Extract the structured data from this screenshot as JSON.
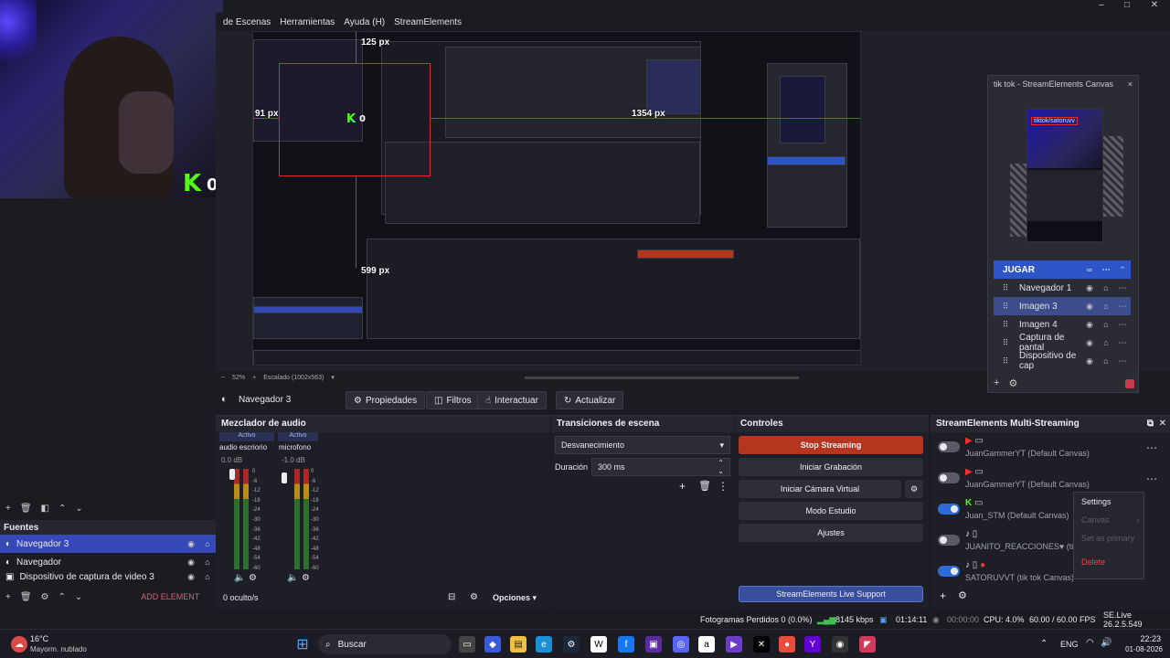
{
  "menubar": {
    "items": [
      "de Escenas",
      "Herramientas",
      "Ayuda (H)",
      "StreamElements"
    ]
  },
  "window_controls": {
    "minimize": "–",
    "maximize": "□",
    "close": "✕"
  },
  "webcam": {
    "kick_count": "0"
  },
  "preview": {
    "measures": {
      "top": "125 px",
      "left": "91 px",
      "right": "1354 px",
      "bottom": "599 px"
    },
    "nested_kick": "0"
  },
  "tiktok_panel": {
    "title": "tik tok - StreamElements Canvas",
    "scene_header": "JUGAR",
    "scenes": [
      "Navegador 1",
      "Imagen 3",
      "Imagen 4",
      "Captura de pantal",
      "Dispositivo de cap"
    ],
    "canvas_text": "tiktok/satoruvv"
  },
  "zoombar": {
    "minus": "−",
    "zoom": "52%",
    "plus": "+",
    "scale": "Escalado (1002x563)"
  },
  "source_bar": {
    "name": "Navegador 3",
    "properties": "Propiedades",
    "filters": "Filtros",
    "interact": "Interactuar",
    "refresh": "Actualizar"
  },
  "sources": {
    "title": "Fuentes",
    "items": [
      "Navegador 3",
      "Navegador",
      "Dispositivo de captura de video 3"
    ],
    "add_element": "ADD ELEMENT"
  },
  "audio_mixer": {
    "title": "Mezclador de audio",
    "channels": [
      {
        "status": "Activo",
        "name": "audio escriorio",
        "db": "0.0 dB"
      },
      {
        "status": "Activo",
        "name": "microfono",
        "db": "-1.0 dB"
      }
    ],
    "scale": [
      "0",
      "-6",
      "-12",
      "-18",
      "-24",
      "-30",
      "-36",
      "-42",
      "-48",
      "-54",
      "-60"
    ],
    "hidden_count": "0 oculto/s",
    "options": "Opciones"
  },
  "transitions": {
    "title": "Transiciones de escena",
    "selected": "Desvanecimiento",
    "duration_label": "Duración",
    "duration_value": "300 ms"
  },
  "controls": {
    "title": "Controles",
    "stop_streaming": "Stop Streaming",
    "start_recording": "Iniciar Grabación",
    "virtual_camera": "Iniciar Cámara Virtual",
    "studio_mode": "Modo Estudio",
    "settings": "Ajustes",
    "support": "StreamElements Live Support"
  },
  "multistream": {
    "title": "StreamElements Multi-Streaming",
    "rows": [
      {
        "name": "JuanGammerYT (Default Canvas)",
        "on": false,
        "platform": "youtube"
      },
      {
        "name": "JuanGammerYT (Default Canvas)",
        "on": false,
        "platform": "youtube"
      },
      {
        "name": "Juan_STM (Default Canvas)",
        "on": true,
        "platform": "kick"
      },
      {
        "name": "JUANITO_REACCIONES♥ (ti",
        "on": false,
        "platform": "tiktok"
      },
      {
        "name": "SATORUVVT (tik tok Canvas)",
        "on": true,
        "platform": "tiktok"
      }
    ],
    "menu": {
      "settings": "Settings",
      "canvas": "Canvas",
      "set_primary": "Set as primary",
      "delete": "Delete"
    }
  },
  "statusbar": {
    "dropped_frames": "Fotogramas Perdidos 0 (0.0%)",
    "bitrate": "8145 kbps",
    "stream_time": "01:14:11",
    "rec_time": "00:00:00",
    "cpu": "CPU: 4.0%",
    "fps": "60.00 / 60.00 FPS",
    "version": "SE.Live 26.2.5.549"
  },
  "taskbar": {
    "weather_temp": "16°C",
    "weather_desc": "Mayorm. nublado",
    "search": "Buscar",
    "lang": "ENG",
    "time": "22:23",
    "date": "01-08-2026"
  },
  "colors": {
    "accent": "#3548b8",
    "stop": "#b5361f",
    "kick": "#53fc18",
    "guide": "#e02929"
  }
}
